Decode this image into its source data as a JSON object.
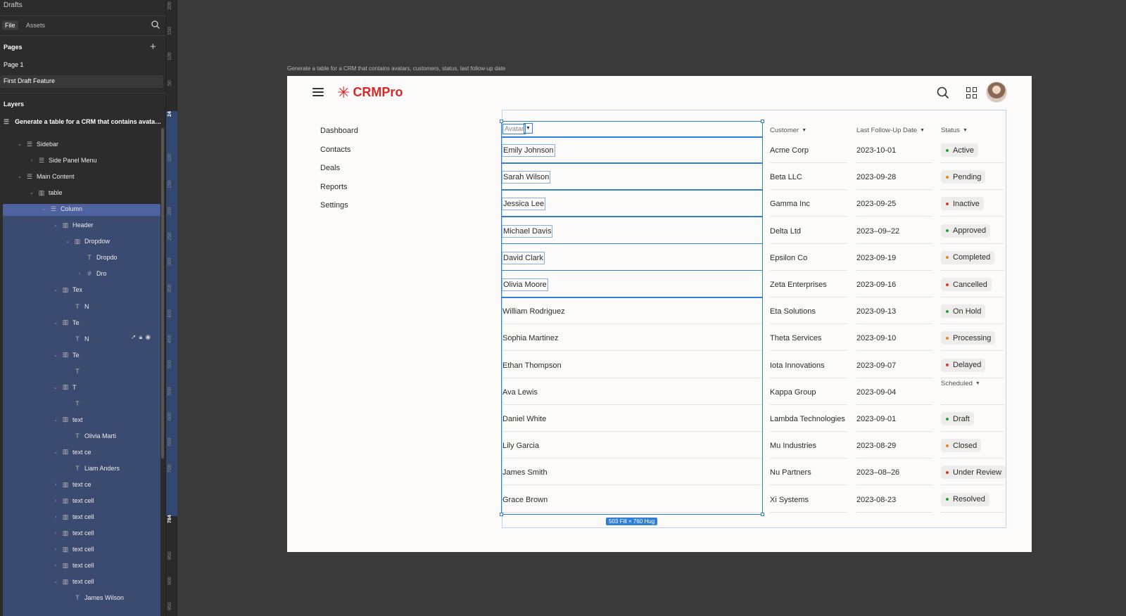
{
  "left_panel": {
    "drafts": "Drafts",
    "tabs": [
      "File",
      "Assets"
    ],
    "pages_title": "Pages",
    "pages": [
      "Page 1",
      "First Draft Feature"
    ],
    "layers_title": "Layers",
    "root_layer": "Generate a table for a CRM that contains avatars, c...",
    "layers": [
      {
        "label": "Sidebar",
        "indent": 1,
        "caret": "⌄",
        "icon": "☰"
      },
      {
        "label": "Side Panel Menu",
        "indent": 2,
        "caret": "›",
        "icon": "☰"
      },
      {
        "label": "Main Content",
        "indent": 1,
        "caret": "⌄",
        "icon": "☰"
      },
      {
        "label": "table",
        "indent": 2,
        "caret": "⌄",
        "icon": "▥"
      },
      {
        "label": "Column",
        "indent": 3,
        "caret": "⌄",
        "icon": "☰"
      },
      {
        "label": "Header",
        "indent": 4,
        "caret": "⌄",
        "icon": "▥"
      },
      {
        "label": "Dropdow",
        "indent": 5,
        "caret": "⌄",
        "icon": "▥"
      },
      {
        "label": "Dropdo",
        "indent": 6,
        "caret": "",
        "icon": "T"
      },
      {
        "label": "Dro",
        "indent": 6,
        "caret": "›",
        "icon": "#"
      },
      {
        "label": "Tex",
        "indent": 4,
        "caret": "⌄",
        "icon": "▥"
      },
      {
        "label": "N",
        "indent": 5,
        "caret": "",
        "icon": "T"
      },
      {
        "label": "Te",
        "indent": 4,
        "caret": "⌄",
        "icon": "▥"
      },
      {
        "label": "N",
        "indent": 5,
        "caret": "",
        "icon": "T"
      },
      {
        "label": "Te",
        "indent": 4,
        "caret": "⌄",
        "icon": "▥"
      },
      {
        "label": "",
        "indent": 5,
        "caret": "",
        "icon": "T"
      },
      {
        "label": "T",
        "indent": 4,
        "caret": "⌄",
        "icon": "▥"
      },
      {
        "label": "",
        "indent": 5,
        "caret": "",
        "icon": "T"
      },
      {
        "label": "text",
        "indent": 4,
        "caret": "⌄",
        "icon": "▥"
      },
      {
        "label": "Olivia Marti",
        "indent": 5,
        "caret": "",
        "icon": "T"
      },
      {
        "label": "text ce",
        "indent": 4,
        "caret": "⌄",
        "icon": "▥"
      },
      {
        "label": "Liam Anders",
        "indent": 5,
        "caret": "",
        "icon": "T"
      },
      {
        "label": "text ce",
        "indent": 4,
        "caret": "›",
        "icon": "▥"
      },
      {
        "label": "text cell",
        "indent": 4,
        "caret": "›",
        "icon": "▥"
      },
      {
        "label": "text cell",
        "indent": 4,
        "caret": "›",
        "icon": "▥"
      },
      {
        "label": "text cell",
        "indent": 4,
        "caret": "›",
        "icon": "▥"
      },
      {
        "label": "text cell",
        "indent": 4,
        "caret": "›",
        "icon": "▥"
      },
      {
        "label": "text cell",
        "indent": 4,
        "caret": "›",
        "icon": "▥"
      },
      {
        "label": "text cell",
        "indent": 4,
        "caret": "⌄",
        "icon": "▥"
      },
      {
        "label": "James Wilson",
        "indent": 5,
        "caret": "",
        "icon": "T"
      }
    ]
  },
  "ruler": {
    "ticks": [
      "200",
      "150",
      "100",
      "50",
      "24",
      "100",
      "150",
      "200",
      "250",
      "300",
      "350",
      "400",
      "450",
      "500",
      "550",
      "600",
      "650",
      "700",
      "784",
      "850",
      "900",
      "950"
    ],
    "highlight_ticks": [
      "24",
      "784"
    ]
  },
  "frame": {
    "label": "Generate a table for a CRM that contains avatars, customers, status,  last follow-up date",
    "brand": "CRMPro",
    "nav": [
      "Dashboard",
      "Contacts",
      "Deals",
      "Reports",
      "Settings"
    ],
    "headers": {
      "avatar": "Avatar",
      "customer": "Customer",
      "date": "Last Follow-Up Date",
      "status": "Status",
      "scheduled": "Scheduled"
    },
    "names": [
      "Emily Johnson",
      "Sarah Wilson",
      "Jessica Lee",
      "Michael Davis",
      "David Clark",
      "Olivia Moore",
      "William Rodriguez",
      "Sophia Martinez",
      "Ethan Thompson",
      "Ava Lewis",
      "Daniel White",
      "Lily Garcia",
      "James Smith",
      "Grace Brown"
    ],
    "customers": [
      "Acme Corp",
      "Beta LLC",
      "Gamma Inc",
      "Delta Ltd",
      "Epsilon Co",
      "Zeta Enterprises",
      "Eta Solutions",
      "Theta Services",
      "Iota Innovations",
      "Kappa Group",
      "Lambda Technologies",
      "Mu Industries",
      "Nu Partners",
      "Xi Systems"
    ],
    "dates": [
      "2023-10-01",
      "2023-09-28",
      "2023-09-25",
      "2023–09–22",
      "2023-09-19",
      "2023-09-16",
      "2023-09-13",
      "2023-09-10",
      "2023-09-07",
      "2023-09-04",
      "2023-09-01",
      "2023-08-29",
      "2023–08–26",
      "2023-08-23"
    ],
    "statuses": [
      {
        "label": "Active",
        "color": "#2e9e44"
      },
      {
        "label": "Pending",
        "color": "#e08a1e"
      },
      {
        "label": "Inactive",
        "color": "#d93a2f"
      },
      {
        "label": "Approved",
        "color": "#2e9e44"
      },
      {
        "label": "Completed",
        "color": "#e08a1e"
      },
      {
        "label": "Cancelled",
        "color": "#d93a2f"
      },
      {
        "label": "On Hold",
        "color": "#2e9e44"
      },
      {
        "label": "Processing",
        "color": "#e08a1e"
      },
      {
        "label": "Delayed",
        "color": "#d93a2f"
      },
      {
        "label": "",
        "color": ""
      },
      {
        "label": "Draft",
        "color": "#2e9e44"
      },
      {
        "label": "Closed",
        "color": "#e08a1e"
      },
      {
        "label": "Under Review",
        "color": "#d93a2f"
      },
      {
        "label": "Resolved",
        "color": "#2e9e44"
      }
    ],
    "selection_size": "503 Fill × 760 Hug"
  },
  "colors": {
    "brand": "#d62828",
    "selection": "#2f7fd6",
    "canvas": "#3a3a3a"
  }
}
